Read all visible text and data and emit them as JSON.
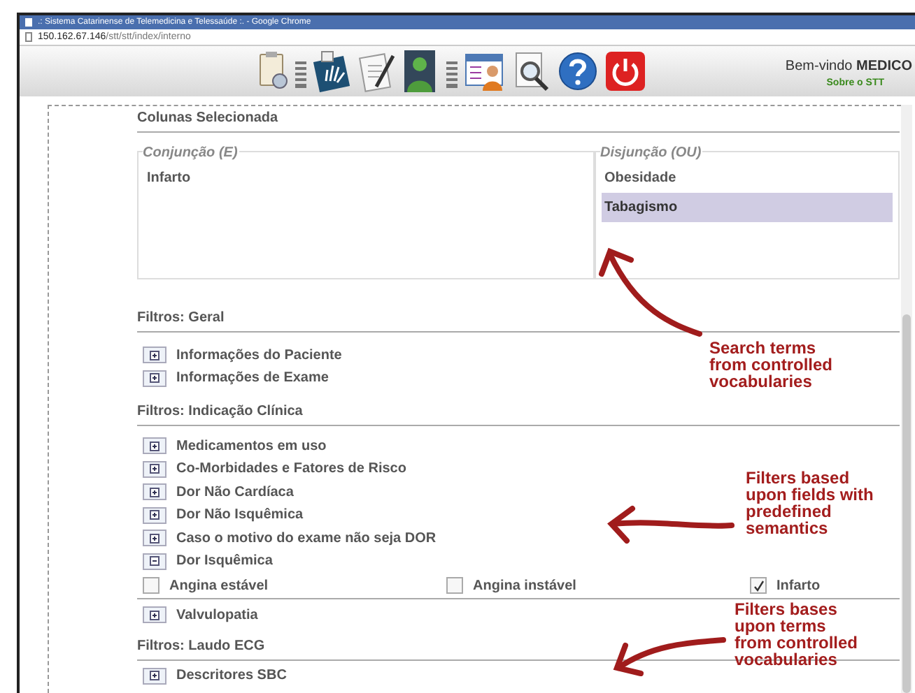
{
  "window": {
    "title": ".: Sistema Catarinense de Telemedicina e Telessaúde :. - Google Chrome"
  },
  "address": {
    "host": "150.162.67.146",
    "path": "/stt/stt/index/interno"
  },
  "toolbar": [
    {
      "kind": "clipboard"
    },
    {
      "kind": "separator"
    },
    {
      "kind": "xray"
    },
    {
      "kind": "document"
    },
    {
      "kind": "person"
    },
    {
      "kind": "separator"
    },
    {
      "kind": "profile"
    },
    {
      "kind": "search"
    },
    {
      "kind": "help"
    },
    {
      "kind": "power"
    }
  ],
  "header": {
    "welcome": "Bem-vindo",
    "user": "MEDICO",
    "link": "Sobre o STT"
  },
  "selected_columns": {
    "title": "Colunas Selecionada",
    "conjunction": {
      "label": "Conjunção (E)",
      "items": [
        {
          "label": "Infarto",
          "selected": false
        }
      ]
    },
    "disjunction": {
      "label": "Disjunção (OU)",
      "items": [
        {
          "label": "Obesidade",
          "selected": false
        },
        {
          "label": "Tabagismo",
          "selected": true
        }
      ]
    }
  },
  "sections": [
    {
      "title": "Filtros: Geral",
      "items": [
        {
          "label": "Informações do Paciente",
          "expanded": false
        },
        {
          "label": "Informações de Exame",
          "expanded": false
        }
      ]
    },
    {
      "title": "Filtros: Indicação Clínica",
      "items": [
        {
          "label": "Medicamentos em uso",
          "expanded": false
        },
        {
          "label": "Co-Morbidades e Fatores de Risco",
          "expanded": false
        },
        {
          "label": "Dor Não Cardíaca",
          "expanded": false
        },
        {
          "label": "Dor Não Isquêmica",
          "expanded": false
        },
        {
          "label": "Caso o motivo do exame não seja DOR",
          "expanded": false
        },
        {
          "label": "Dor Isquêmica",
          "expanded": true,
          "options": [
            {
              "label": "Angina estável",
              "checked": false
            },
            {
              "label": "Angina instável",
              "checked": false
            },
            {
              "label": "Infarto",
              "checked": true
            }
          ]
        },
        {
          "label": "Valvulopatia",
          "expanded": false
        }
      ]
    },
    {
      "title": "Filtros: Laudo ECG",
      "items": [
        {
          "label": "Descritores SBC",
          "expanded": false
        }
      ]
    }
  ],
  "annotations": [
    {
      "lines": [
        "Search terms",
        "from controlled",
        "vocabularies"
      ]
    },
    {
      "lines": [
        "Filters based",
        "upon fields with",
        "predefined",
        "semantics"
      ]
    },
    {
      "lines": [
        "Filters bases",
        "upon terms",
        "from controlled",
        "vocabularies"
      ]
    }
  ]
}
